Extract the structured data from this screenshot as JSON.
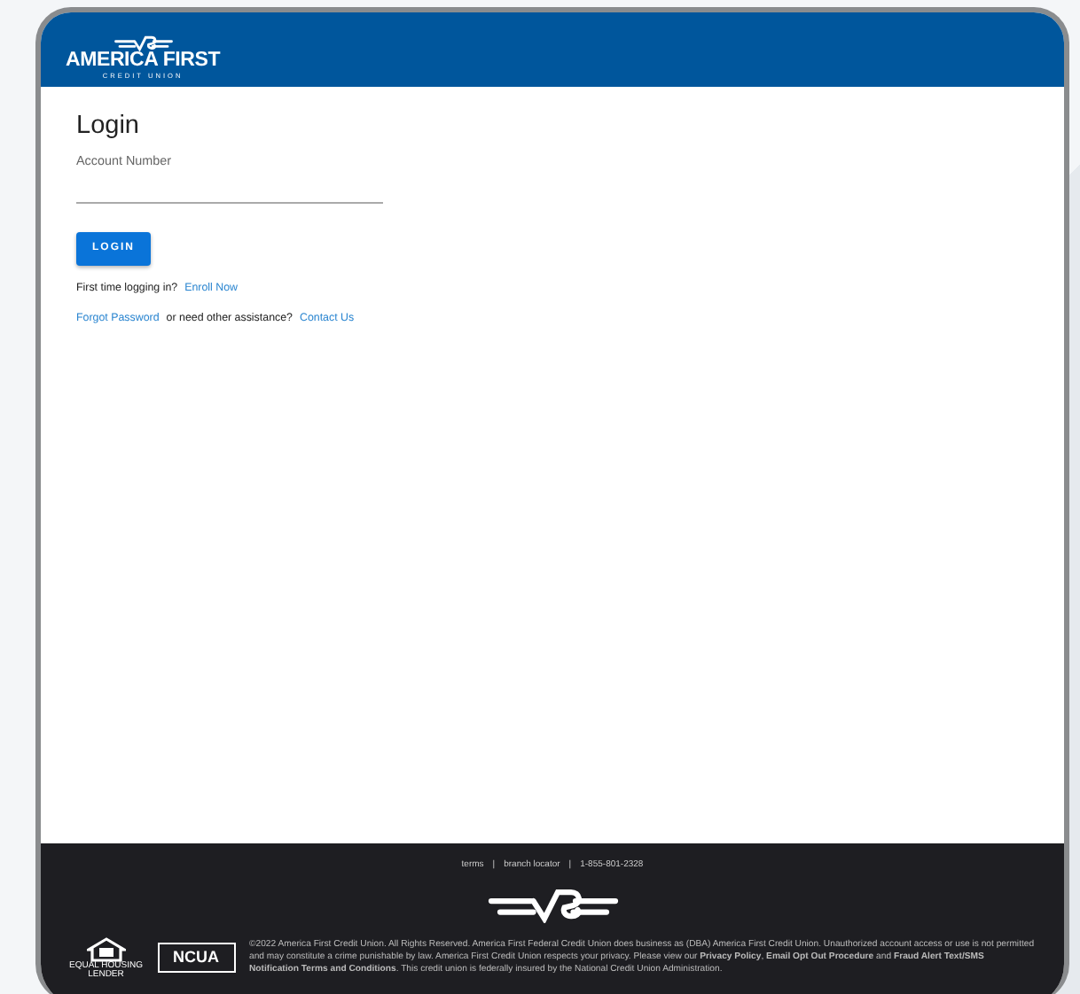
{
  "header": {
    "logo": {
      "name": "AMERICA FIRST",
      "tagline": "CREDIT UNION"
    }
  },
  "login": {
    "title": "Login",
    "field": {
      "label": "Account Number"
    },
    "button": "LOGIN",
    "lines": [
      {
        "text": "First time logging in?",
        "link": "Enroll Now"
      },
      {
        "link_first": "Forgot Password",
        "text": "or need other assistance?",
        "link": "Contact Us"
      }
    ]
  },
  "footer": {
    "links": [
      {
        "text": "terms"
      },
      {
        "text": "branch locator"
      },
      {
        "text": "1-855-801-2328"
      }
    ],
    "separator": "|",
    "equal_housing": {
      "line1": "EQUAL HOUSING",
      "line2": "LENDER"
    },
    "ncua": "NCUA",
    "legal": "©2022 America First Credit Union. All Rights Reserved. America First Federal Credit Union does business as (DBA) America First Credit Union. Unauthorized account access or use is not permitted and may constitute a crime punishable by law. America First Credit Union respects your privacy. Please view our **Privacy Policy**, **Email Opt Out Procedure** and **Fraud Alert Text/SMS Notification Terms and Conditions**. This credit union is federally insured by the National Credit Union Administration."
  }
}
